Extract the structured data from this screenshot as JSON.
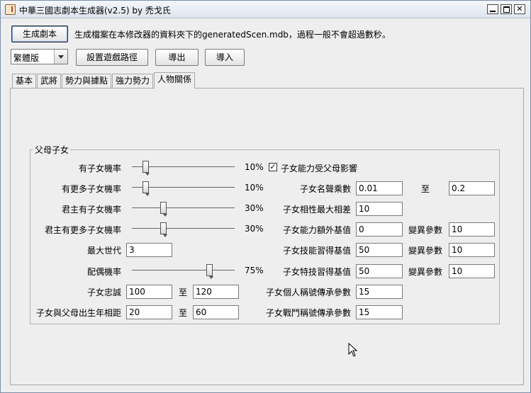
{
  "window": {
    "title": "中華三國志劇本生成器(v2.5) by 禿戈氏",
    "minimize": "",
    "maximize": "",
    "close": "✕"
  },
  "toolbar": {
    "generate_label": "生成劇本",
    "info_text": "生成檔案在本修改器的資料夾下的generatedScen.mdb，過程一般不會超過數秒。",
    "language_value": "繁體版",
    "set_path_label": "設置遊戲路徑",
    "export_label": "導出",
    "import_label": "導入"
  },
  "tabs": [
    {
      "label": "基本",
      "active": false
    },
    {
      "label": "武將",
      "active": false
    },
    {
      "label": "勢力與據點",
      "active": false
    },
    {
      "label": "強力勢力",
      "active": false
    },
    {
      "label": "人物關係",
      "active": true
    }
  ],
  "parent_child": {
    "title": "父母子女",
    "child_prob": {
      "label": "有子女機率",
      "value": 10,
      "text": "10%"
    },
    "more_child_prob": {
      "label": "有更多子女機率",
      "value": 10,
      "text": "10%"
    },
    "ruler_child_prob": {
      "label": "君主有子女機率",
      "value": 30,
      "text": "30%"
    },
    "ruler_more_child_prob": {
      "label": "君主有更多子女機率",
      "value": 30,
      "text": "30%"
    },
    "max_generation": {
      "label": "最大世代",
      "value": "3"
    },
    "spouse_prob": {
      "label": "配偶機率",
      "value": 75,
      "text": "75%"
    },
    "loyalty": {
      "label": "子女忠誠",
      "from": "100",
      "to_label": "至",
      "to": "120"
    },
    "birth_gap": {
      "label": "子女與父母出生年相距",
      "from": "20",
      "to_label": "至",
      "to": "60"
    },
    "ability_affected": {
      "label": "子女能力受父母影響",
      "checked": true,
      "mark": "✓"
    },
    "fame_multiplier": {
      "label": "子女名聲乘數",
      "from": "0.01",
      "to_label": "至",
      "to": "0.2"
    },
    "max_affinity_diff": {
      "label": "子女相性最大相差",
      "value": "10"
    },
    "ability_base": {
      "label": "子女能力額外基值",
      "value": "0",
      "var_label": "變異參數",
      "var_value": "10"
    },
    "skill_base": {
      "label": "子女技能習得基值",
      "value": "50",
      "var_label": "變異參數",
      "var_value": "10"
    },
    "trait_base": {
      "label": "子女特技習得基值",
      "value": "50",
      "var_label": "變異參數",
      "var_value": "10"
    },
    "personal_title_param": {
      "label": "子女個人稱號傳承參數",
      "value": "15"
    },
    "battle_title_param": {
      "label": "子女戰鬥稱號傳承參數",
      "value": "15"
    }
  }
}
